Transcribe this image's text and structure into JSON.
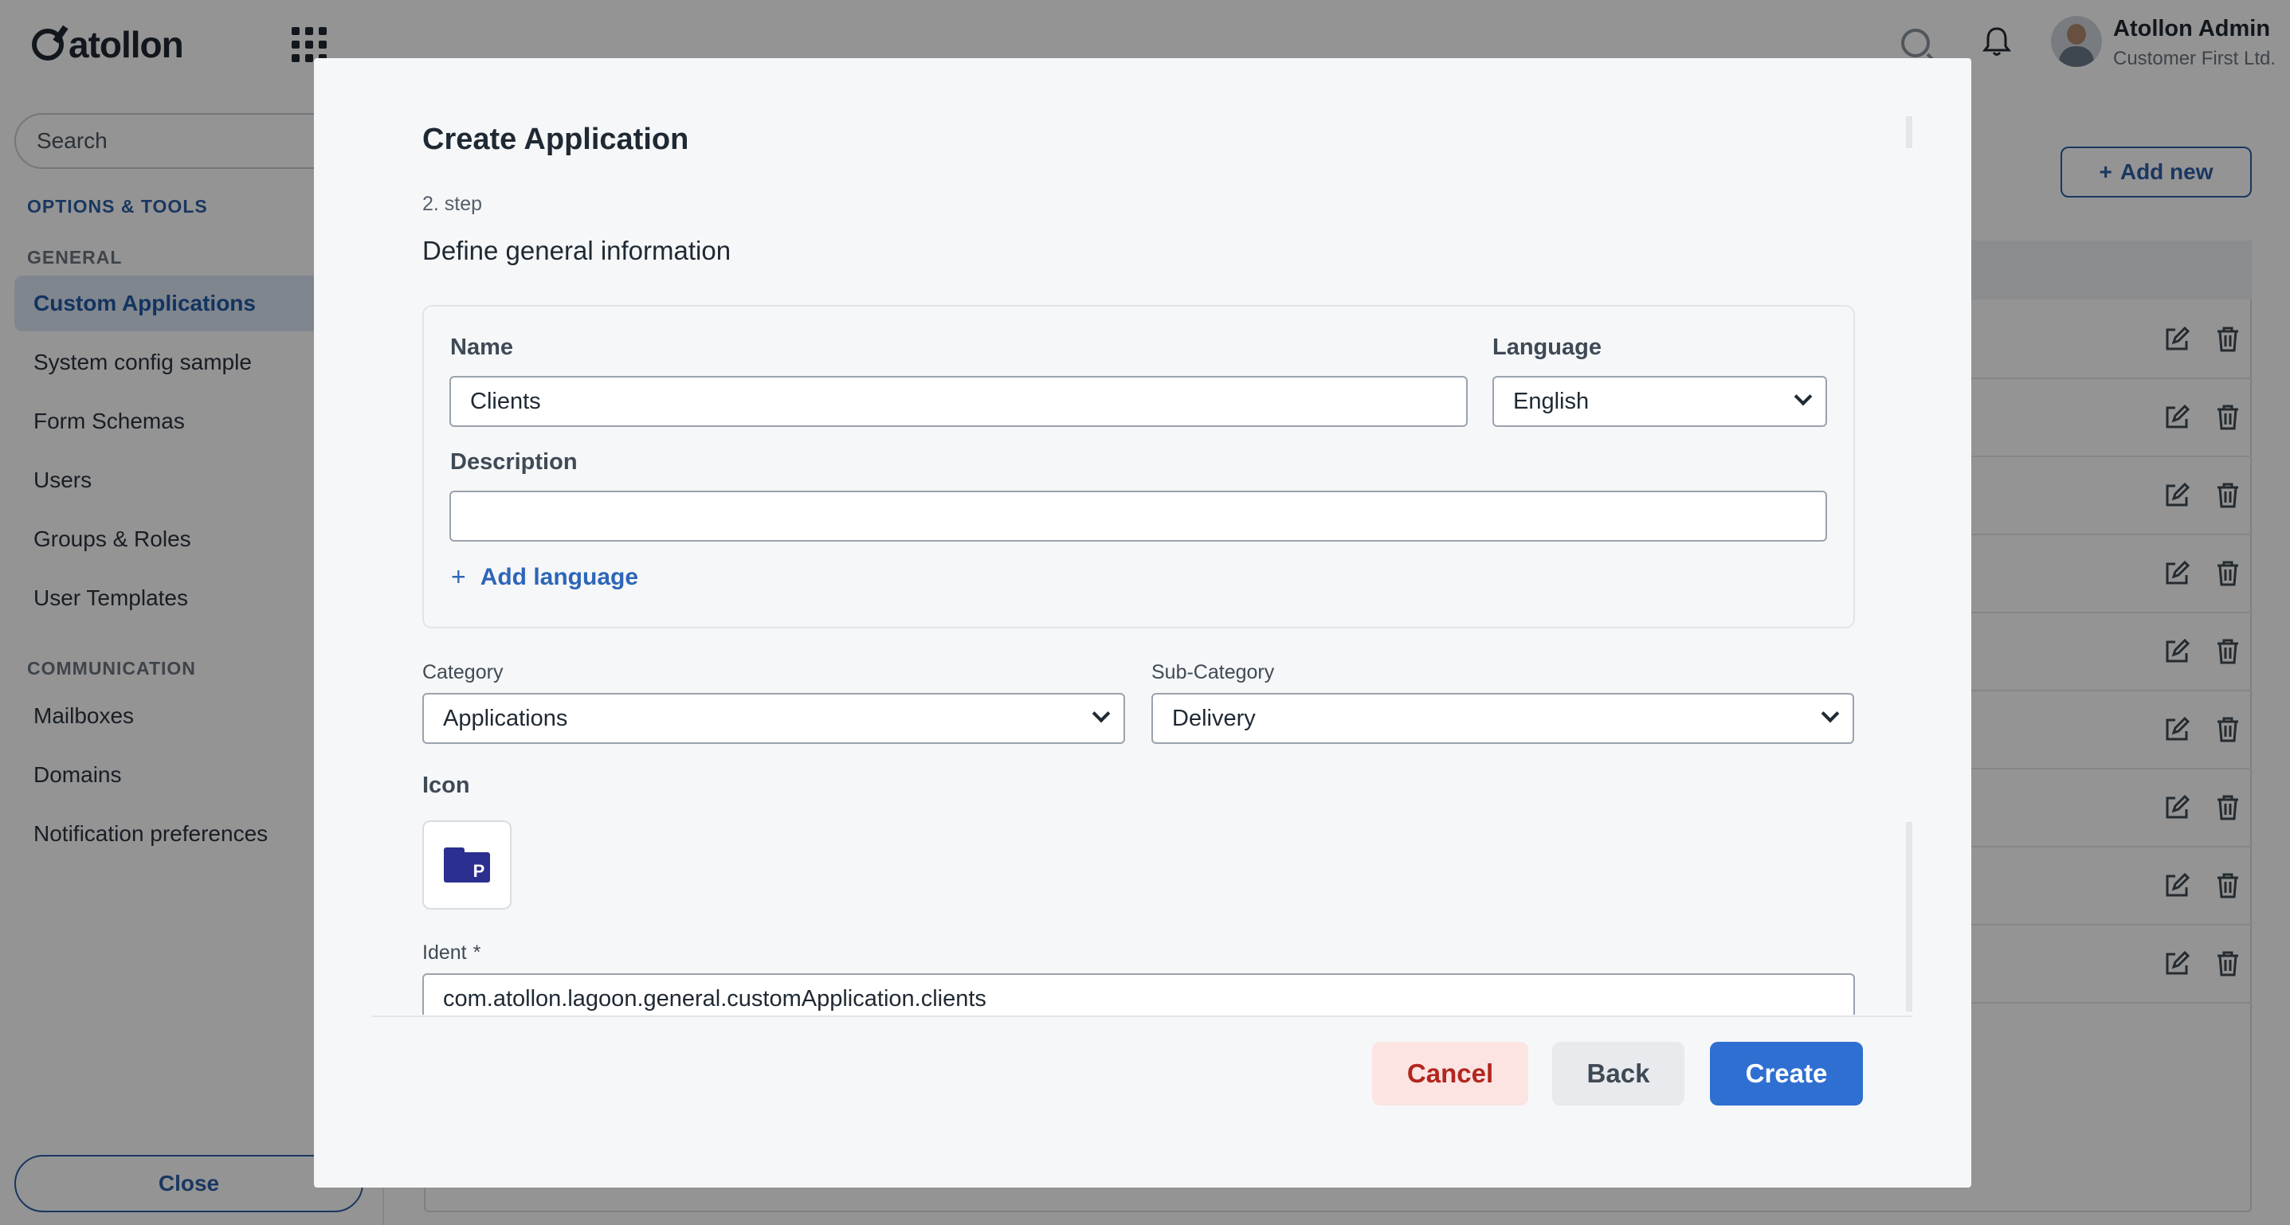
{
  "app": {
    "logo_text": "atollon",
    "user_name": "Atollon Admin",
    "user_org": "Customer First Ltd."
  },
  "sidebar": {
    "search_placeholder": "Search",
    "section_options": "OPTIONS & TOOLS",
    "section_general": "GENERAL",
    "items_general": [
      {
        "label": "Custom Applications",
        "active": true
      },
      {
        "label": "System config sample"
      },
      {
        "label": "Form Schemas"
      },
      {
        "label": "Users"
      },
      {
        "label": "Groups & Roles"
      },
      {
        "label": "User Templates"
      }
    ],
    "section_communication": "COMMUNICATION",
    "items_communication": [
      {
        "label": "Mailboxes"
      },
      {
        "label": "Domains"
      },
      {
        "label": "Notification preferences"
      }
    ],
    "close_label": "Close"
  },
  "main": {
    "add_new_label": "Add new"
  },
  "modal": {
    "title": "Create Application",
    "step_label": "2. step",
    "step_heading": "Define general information",
    "name_label": "Name",
    "name_value": "Clients",
    "language_label": "Language",
    "language_value": "English",
    "description_label": "Description",
    "description_value": "",
    "add_language_label": "Add language",
    "category_label": "Category",
    "category_value": "Applications",
    "subcategory_label": "Sub-Category",
    "subcategory_value": "Delivery",
    "icon_label": "Icon",
    "icon_badge": "P",
    "ident_label": "Ident",
    "ident_required": "*",
    "ident_value": "com.atollon.lagoon.general.customApplication.clients",
    "cancel_label": "Cancel",
    "back_label": "Back",
    "create_label": "Create"
  },
  "colors": {
    "accent": "#2f6fd1",
    "cancel_bg": "#fbe4e2",
    "cancel_text": "#b3261e",
    "active_nav_bg": "#dce7f5"
  },
  "icons": [
    "grid-icon",
    "search-icon",
    "bell-icon",
    "edit-icon",
    "trash-icon",
    "plus-icon",
    "chevron-down-icon",
    "folder-icon"
  ]
}
